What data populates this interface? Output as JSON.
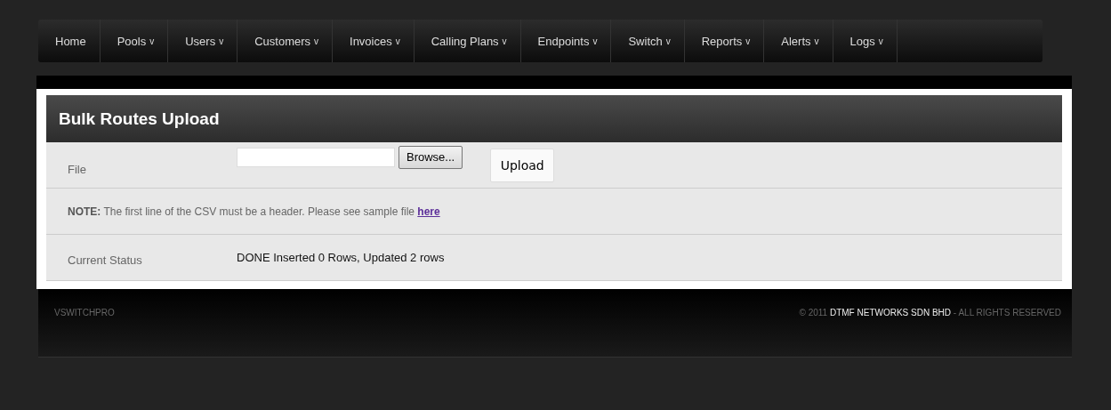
{
  "nav": [
    {
      "label": "Home"
    },
    {
      "label": "Pools",
      "caret": "v"
    },
    {
      "label": "Users",
      "caret": "v"
    },
    {
      "label": "Customers",
      "caret": "v"
    },
    {
      "label": "Invoices",
      "caret": "v"
    },
    {
      "label": "Calling Plans",
      "caret": "v"
    },
    {
      "label": "Endpoints",
      "caret": "v"
    },
    {
      "label": "Switch",
      "caret": "v"
    },
    {
      "label": "Reports",
      "caret": "v"
    },
    {
      "label": "Alerts",
      "caret": "v"
    },
    {
      "label": "Logs",
      "caret": "v"
    }
  ],
  "panel": {
    "title": "Bulk Routes Upload",
    "file_label": "File",
    "browse_button": "Browse...",
    "upload_button": "Upload",
    "note": "**NOTE:** The first line of the CSV must be a header. Please see sample file",
    "note_link": "here",
    "status_label": "Current Status",
    "status_value": "DONE Inserted 0 Rows, Updated 2 rows"
  },
  "footer": {
    "brand": "VSWITCHPRO",
    "copyright": "© 2011 **DTMF NETWORKS SDN BHD** - ALL RIGHTS RESERVED"
  }
}
